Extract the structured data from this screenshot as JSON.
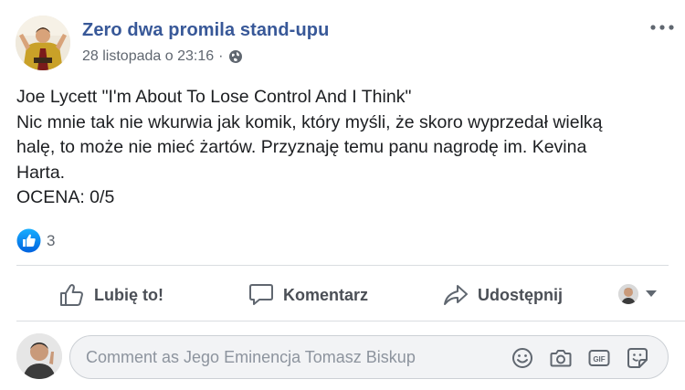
{
  "post": {
    "page_name": "Zero dwa promila stand-upu",
    "timestamp": "28 listopada o 23:16",
    "separator": "·",
    "audience_icon": "globe-icon",
    "body_lines": [
      "Joe Lycett \"I'm About To Lose Control And I Think\"",
      "Nic mnie tak nie wkurwia jak komik, który myśli, że skoro wyprzedał wielką",
      "halę, to może nie mieć żartów. Przyznaję temu panu nagrodę im. Kevina",
      "Harta.",
      "OCENA: 0/5"
    ],
    "reaction_count": "3"
  },
  "actions": {
    "like_label": "Lubię to!",
    "comment_label": "Komentarz",
    "share_label": "Udostępnij"
  },
  "comment": {
    "placeholder": "Comment as Jego Eminencja Tomasz Biskup",
    "icons": [
      "emoji-icon",
      "camera-icon",
      "gif-icon",
      "sticker-icon"
    ]
  },
  "colors": {
    "brand_link": "#385898",
    "like_blue": "#1877f2",
    "muted_text": "#606770",
    "action_text": "#4b4f56"
  }
}
